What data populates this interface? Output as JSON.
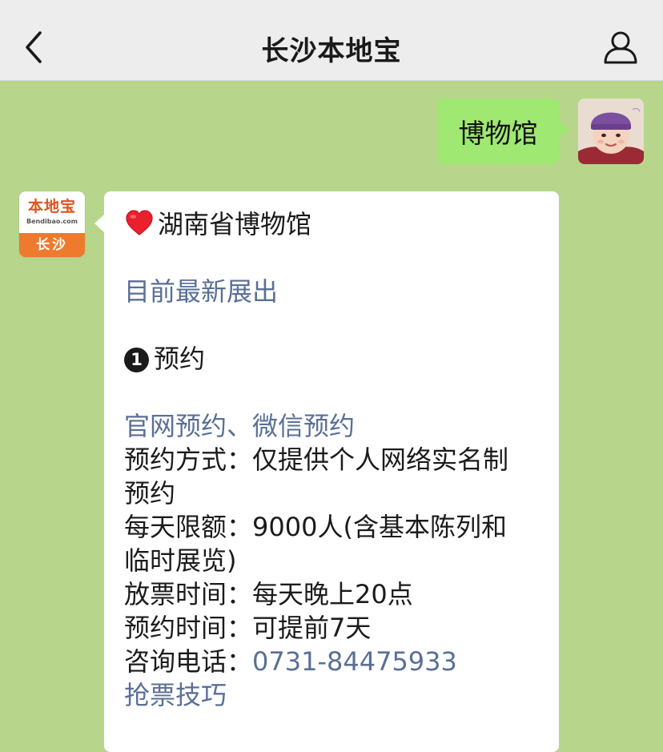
{
  "header": {
    "title": "长沙本地宝",
    "back_icon": "chevron-left-icon",
    "profile_icon": "person-icon"
  },
  "outgoing": {
    "text": "博物馆"
  },
  "bot": {
    "logo_main": "本地宝",
    "logo_sub": "Bendibao.com",
    "logo_city": "长沙"
  },
  "message": {
    "title": "湖南省博物馆",
    "latest_link": "目前最新展出",
    "step_number": "1",
    "step_label": "预约",
    "official_link": "官网预约",
    "separator": "、",
    "wechat_link": "微信预约",
    "method_label": "预约方式：",
    "method_value": "仅提供个人网络实名制",
    "method_value_cont": "预约",
    "limit_label": "每天限额：",
    "limit_value": "9000人(含基本陈列和",
    "limit_value_cont": "临时展览)",
    "release_label": "放票时间：",
    "release_value": "每天晚上20点",
    "advance_label": "预约时间：",
    "advance_value": "可提前7天",
    "phone_label": "咨询电话：",
    "phone_value": "0731-84475933",
    "tips_link": "抢票技巧"
  },
  "colors": {
    "chat_background": "#b8d68b",
    "header_background": "#ededed",
    "outgoing_bubble": "#9fe872",
    "incoming_bubble": "#ffffff",
    "link": "#5a6f96",
    "logo_orange": "#ee7a2e"
  }
}
